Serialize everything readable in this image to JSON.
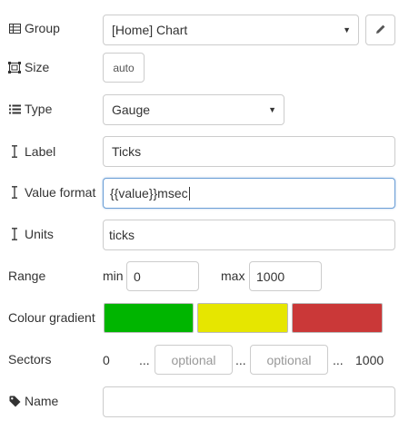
{
  "group": {
    "label": "Group",
    "value": "[Home] Chart"
  },
  "size": {
    "label": "Size",
    "value": "auto"
  },
  "type": {
    "label": "Type",
    "value": "Gauge"
  },
  "label_field": {
    "label": "Label",
    "value": "Ticks"
  },
  "value_format": {
    "label": "Value format",
    "value": "{{value}}msec"
  },
  "units": {
    "label": "Units",
    "value": "ticks"
  },
  "range": {
    "label": "Range",
    "min_label": "min",
    "min_value": "0",
    "max_label": "max",
    "max_value": "1000"
  },
  "colour_gradient": {
    "label": "Colour gradient",
    "colors": [
      "#00b500",
      "#e6e600",
      "#ca3838"
    ]
  },
  "sectors": {
    "label": "Sectors",
    "start": "0",
    "dots1": "...",
    "placeholder1": "optional",
    "dots2": "...",
    "placeholder2": "optional",
    "dots3": "...",
    "end": "1000"
  },
  "name": {
    "label": "Name",
    "value": ""
  },
  "icons": {
    "group": "table-icon",
    "size": "resize-icon",
    "type": "list-icon",
    "text": "text-cursor-icon",
    "tag": "tag-icon",
    "edit": "pencil-icon",
    "dropdown": "caret-down-icon"
  }
}
